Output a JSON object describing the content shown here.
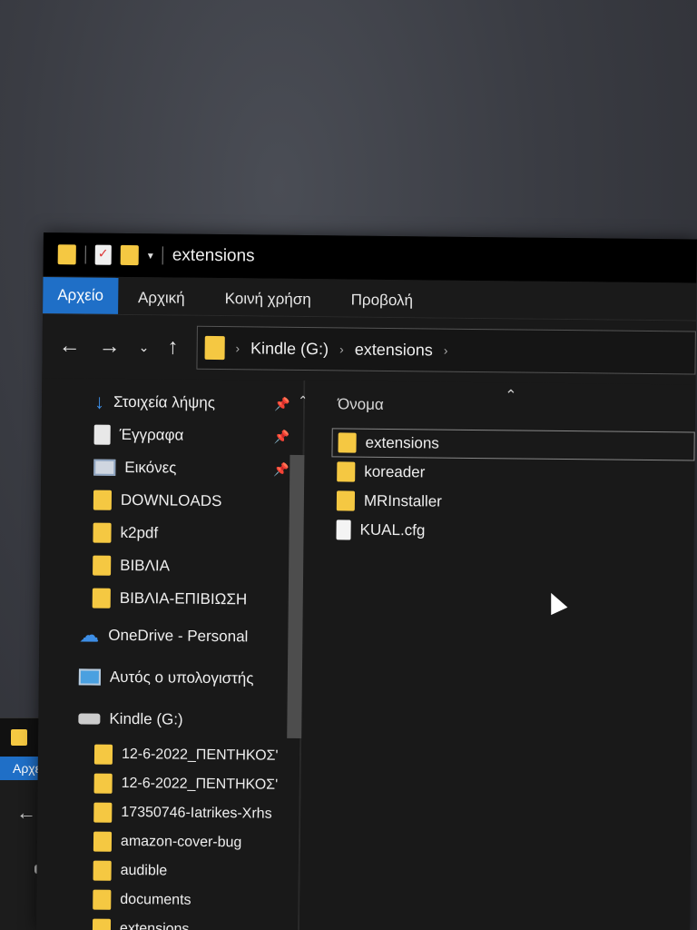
{
  "window": {
    "title": "extensions"
  },
  "ribbon": {
    "tabs": [
      "Αρχείο",
      "Αρχική",
      "Κοινή χρήση",
      "Προβολή"
    ]
  },
  "address": {
    "segments": [
      "Kindle (G:)",
      "extensions"
    ]
  },
  "nav_pane": {
    "quick_access": [
      {
        "label": "Στοιχεία λήψης",
        "icon": "download-icon",
        "pinned": true
      },
      {
        "label": "Έγγραφα",
        "icon": "document-icon",
        "pinned": true
      },
      {
        "label": "Εικόνες",
        "icon": "pictures-icon",
        "pinned": true
      },
      {
        "label": "DOWNLOADS",
        "icon": "folder-icon",
        "pinned": false
      },
      {
        "label": "k2pdf",
        "icon": "folder-icon",
        "pinned": false
      },
      {
        "label": "ΒΙΒΛΙΑ",
        "icon": "folder-icon",
        "pinned": false
      },
      {
        "label": "ΒΙΒΛΙΑ-ΕΠΙΒΙΩΣΗ",
        "icon": "folder-icon",
        "pinned": false
      }
    ],
    "onedrive": "OneDrive - Personal",
    "this_pc": "Αυτός ο υπολογιστής",
    "kindle": "Kindle (G:)",
    "kindle_children": [
      "12-6-2022_ΠΕΝΤΗΚΟΣ'",
      "12-6-2022_ΠΕΝΤΗΚΟΣ'",
      "17350746-Iatrikes-Xrhs",
      "amazon-cover-bug",
      "audible",
      "documents",
      "extensions"
    ]
  },
  "file_list": {
    "column_name": "Όνομα",
    "items": [
      {
        "name": "extensions",
        "type": "folder",
        "selected": true
      },
      {
        "name": "koreader",
        "type": "folder",
        "selected": false
      },
      {
        "name": "MRInstaller",
        "type": "folder",
        "selected": false
      },
      {
        "name": "KUAL.cfg",
        "type": "file",
        "selected": false
      }
    ]
  },
  "background_window": {
    "tab": "Αρχεί"
  },
  "colors": {
    "accent": "#1f6fc7",
    "folder": "#f5c842",
    "window_bg": "#191919",
    "titlebar_bg": "#000000"
  }
}
